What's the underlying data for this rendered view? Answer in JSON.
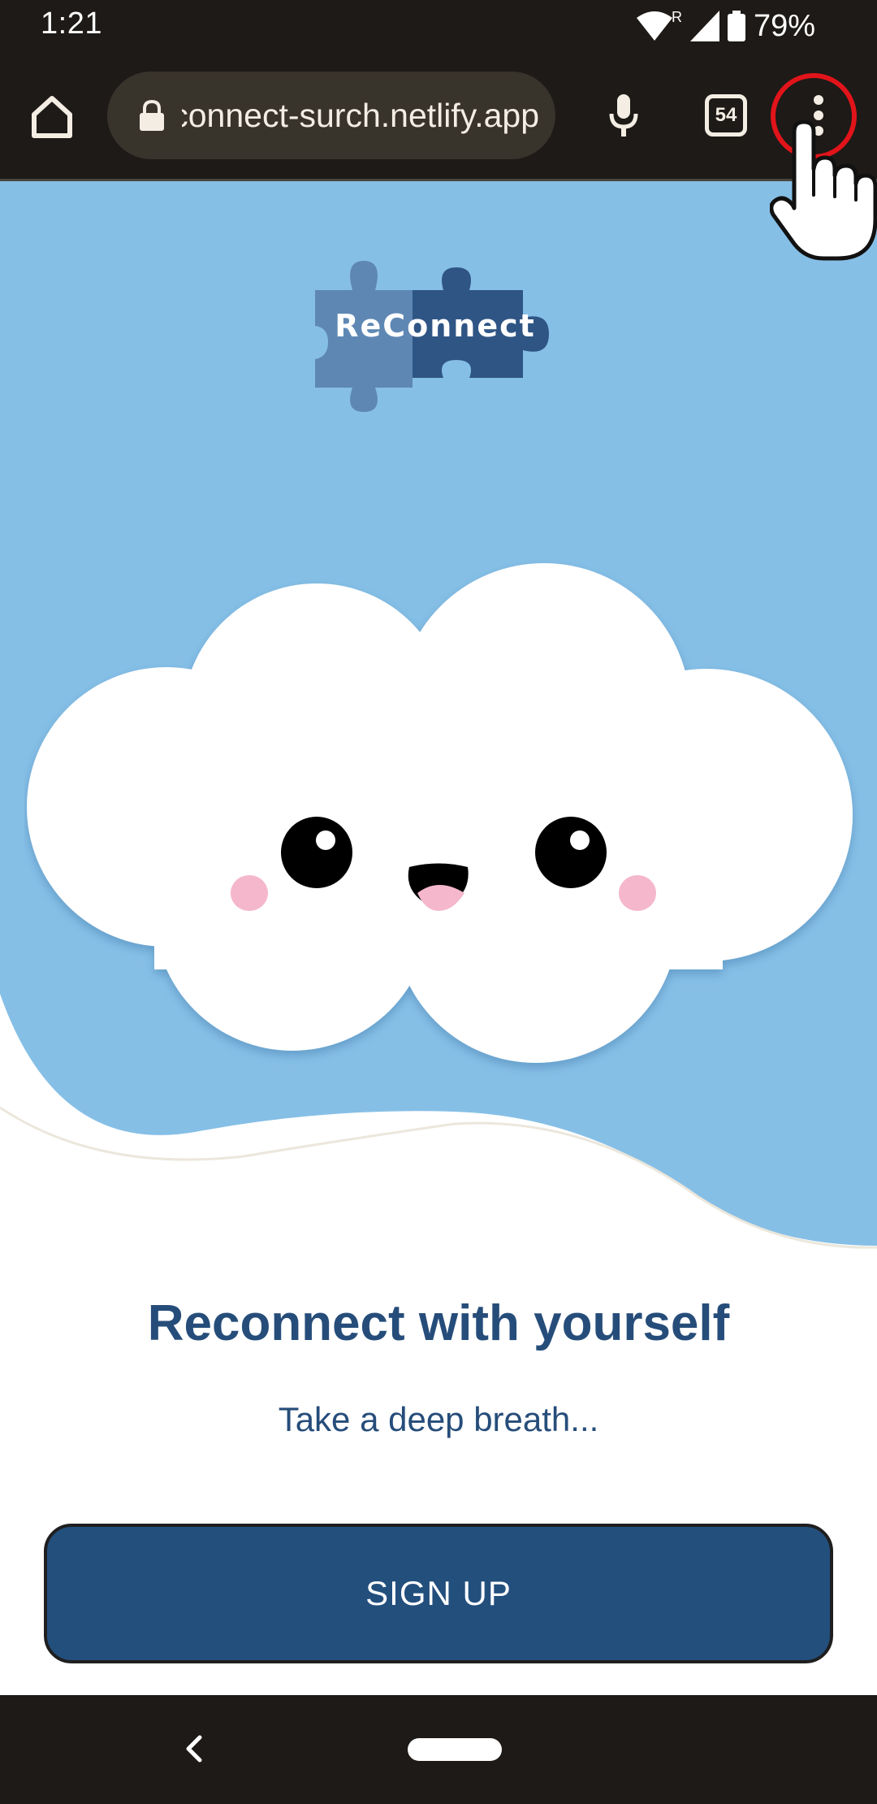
{
  "status_bar": {
    "time": "1:21",
    "battery": "79%",
    "icons": [
      "wifi-icon",
      "roaming-indicator",
      "signal-icon",
      "battery-icon"
    ],
    "roaming_label": "R"
  },
  "browser": {
    "url": "reconnect-surch.netlify.app",
    "tab_count": "54",
    "icons": [
      "home-icon",
      "lock-icon",
      "microphone-icon",
      "tabs-icon",
      "more-options-icon"
    ]
  },
  "page": {
    "logo_text": "ReConnect",
    "headline": "Reconnect with yourself",
    "subline": "Take a deep breath...",
    "signup_label": "SIGN UP"
  },
  "colors": {
    "sky": "#86bfe6",
    "brand_dark": "#264d7a",
    "button": "#234f7d",
    "chrome": "#1d1a17",
    "tap_highlight": "#e0141a"
  },
  "overlay": {
    "icons": [
      "tap-highlight-circle",
      "pointer-hand-icon"
    ]
  }
}
